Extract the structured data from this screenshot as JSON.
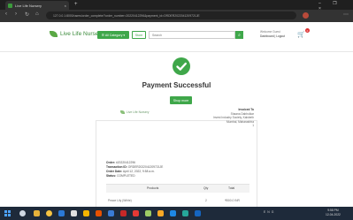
{
  "browser": {
    "tab_title": "Live Life Nursery",
    "tab_close": "×",
    "new_tab": "+",
    "window_controls": "– ❐ ×",
    "back": "‹",
    "forward": "›",
    "reload": "↻",
    "home": "⌂",
    "url": "127.0.0.1:8000/users/order_complete/?order_number=20220412296&payment_id=ORDER2022041209721JE",
    "menu": "⋯"
  },
  "header": {
    "logo_text": "Live Life Nursery",
    "all_categories_label": "☰ All Category ▾",
    "store_label": "Store",
    "search_placeholder": "Search",
    "search_icon": "⌕",
    "welcome_line": "Welcome Guest",
    "user_line": "Dashboard | Logout",
    "cart_icon": "🛒",
    "cart_count": "0"
  },
  "main": {
    "title": "Payment Successful",
    "shop_more_label": "Shop more"
  },
  "invoice": {
    "logo_text": "Live Life Nursery",
    "invoiced_to_heading": "Invoiced To",
    "invoiced_to_lines": [
      "Shaana Dabholkar",
      "Invest Industry Society, Kalsheth",
      "Mumbai, Maharashtra",
      "1"
    ],
    "order_label": "Order:",
    "order_value": "#20220412296",
    "transaction_label": "Transaction ID:",
    "transaction_value": "ORDER2022041209721JE",
    "order_date_label": "Order Date:",
    "order_date_value": "April 12, 2022, 9:58 a.m.",
    "status_label": "Status:",
    "status_value": "COMPLETED",
    "table_headers": [
      "Products",
      "Qty",
      "Total"
    ],
    "rows": [
      {
        "product": "Peace Lily (White)",
        "qty": "2",
        "total": "₹500.0 INR"
      }
    ]
  },
  "taskbar": {
    "tray_text": "ENG",
    "time": "9:58 PM",
    "date": "12-04-2022"
  },
  "colors": {
    "brand_green": "#3fa74a"
  }
}
